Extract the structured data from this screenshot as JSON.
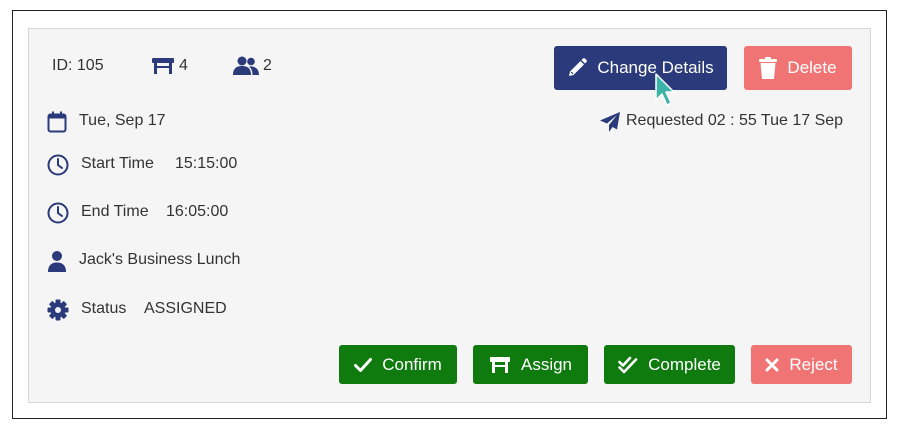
{
  "header": {
    "id_text": "ID: 105",
    "table_count": "4",
    "people_count": "2"
  },
  "actions": {
    "change_details_label": "Change Details",
    "delete_label": "Delete"
  },
  "details": {
    "date": "Tue, Sep 17",
    "requested": "Requested 02 : 55 Tue 17 Sep",
    "start_label": "Start Time",
    "start_value": "15:15:00",
    "end_label": "End Time",
    "end_value": "16:05:00",
    "name": "Jack's Business Lunch",
    "status_label": "Status",
    "status_value": "ASSIGNED"
  },
  "footer": {
    "confirm_label": "Confirm",
    "assign_label": "Assign",
    "complete_label": "Complete",
    "reject_label": "Reject"
  },
  "colors": {
    "primary": "#2a3a7a",
    "danger": "#f07474",
    "success": "#0f7b0f",
    "icon": "#2a3a7a",
    "cursor": "#3bb3a8"
  },
  "icons": {
    "table": "table-icon",
    "people": "people-icon",
    "edit": "pencil-icon",
    "delete": "trash-icon",
    "date": "calendar-icon",
    "requested": "paper-plane-icon",
    "time": "clock-icon",
    "person": "user-icon",
    "status": "gear-icon",
    "confirm": "check-icon",
    "assign": "table-icon",
    "complete": "double-check-icon",
    "reject": "x-icon"
  }
}
